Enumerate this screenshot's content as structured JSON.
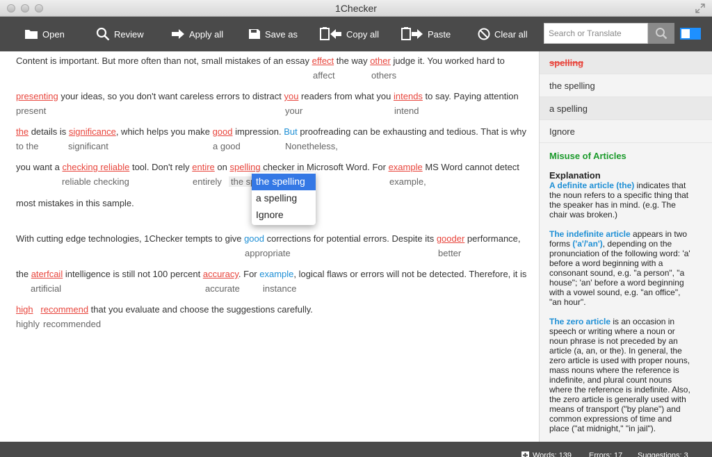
{
  "window": {
    "title": "1Checker"
  },
  "toolbar": {
    "open": "Open",
    "review": "Review",
    "apply_all": "Apply all",
    "save_as": "Save as",
    "copy_all": "Copy all",
    "paste": "Paste",
    "clear_all": "Clear all"
  },
  "search": {
    "placeholder": "Search or Translate"
  },
  "editor": {
    "l1": {
      "a": "Content is important. But more often than not, small mistakes of an essay ",
      "e1": "effect",
      "b": " the way ",
      "e2": "other",
      "c": " judge it. You worked hard to"
    },
    "s1": {
      "a": "affect",
      "b": "others"
    },
    "l2": {
      "e1": "presenting",
      "a": " your ideas, so you don't want careless errors to distract ",
      "e2": "you",
      "b": " readers from what you ",
      "e3": "intends",
      "c": " to say. Paying attention"
    },
    "s2": {
      "a": "present",
      "b": "your",
      "c": "intend"
    },
    "l3": {
      "e1": "the",
      "a": " details is ",
      "e2": "significance",
      "b": ", which helps you make ",
      "e3": "good",
      "c": " impression. ",
      "e4": "But",
      "d": " proofreading can be exhausting and tedious. That is why"
    },
    "s3": {
      "a": "to the",
      "b": "significant",
      "c": "a good",
      "d": "Nonetheless,"
    },
    "l4": {
      "a": "you want a ",
      "e1": "checking reliable",
      "b": " tool. Don't rely ",
      "e2": "entire",
      "c": " on ",
      "e3": "spelling",
      "d": " checker in Microsoft Word. For ",
      "e4": "example",
      "f": " MS Word cannot detect"
    },
    "s4": {
      "a": "reliable checking",
      "b": "entirely",
      "c": "the sp",
      "d": "example,"
    },
    "l5": "most mistakes in this sample.",
    "l6": {
      "a": "With cutting edge technologies, 1Checker tempts to give ",
      "e1": "good",
      "b": " corrections for potential errors. Despite its ",
      "e2": "gooder",
      "c": " performance,"
    },
    "s6": {
      "a": "appropriate",
      "b": "better"
    },
    "l7": {
      "a": "the ",
      "e1": "aterfcail",
      "b": " intelligence is still not 100 percent ",
      "e2": "accuracy",
      "c": ". For ",
      "e3": "example",
      "d": ", logical flaws or errors will not be detected. Therefore, it is"
    },
    "s7": {
      "a": "artificial",
      "b": "accurate",
      "c": "instance"
    },
    "l8": {
      "e1": "high",
      "e2": "recommend",
      "a": " that you evaluate and choose the suggestions carefully."
    },
    "s8": {
      "a": "highly",
      "b": "recommended"
    }
  },
  "popup": {
    "items": [
      "the spelling",
      "a spelling",
      "Ignore"
    ]
  },
  "panel": {
    "error_word": "spelling",
    "options": [
      "the spelling",
      "a spelling",
      "Ignore"
    ],
    "category": "Misuse of Articles",
    "explanation_heading": "Explanation",
    "p1_term": "A definite article (the)",
    "p1_rest": " indicates that the noun refers to a specific thing that the speaker has in mind. (e.g. The chair was broken.)",
    "p2_term": "The indefinite article",
    "p2_mid": " appears in two forms ",
    "p2_forms": "('a'/'an')",
    "p2_rest": ", depending on the pronunciation of the following word: 'a' before a word beginning with a consonant sound, e.g. \"a person\", \"a house\"; 'an' before a word beginning with a vowel sound, e.g. \"an office\", \"an hour\".",
    "p3_term": "The zero article",
    "p3_rest": " is an occasion in speech or writing where a noun or noun phrase is not preceded by an article (a, an, or the). In general, the zero article is used with proper nouns, mass nouns where the reference is indefinite, and plural count nouns where the reference is indefinite. Also, the zero article is generally used with means of transport (\"by plane\") and common expressions of time and place (\"at midnight,\" \"in jail\")."
  },
  "status": {
    "words": "Words: 139",
    "errors": "Errors: 17",
    "suggestions": "Suggestions: 3"
  },
  "colors": {
    "error": "#e8453c",
    "link": "#1e8fd5",
    "category": "#1a9a2a",
    "toolbar": "#4a4a4a",
    "selection": "#3478e5"
  }
}
